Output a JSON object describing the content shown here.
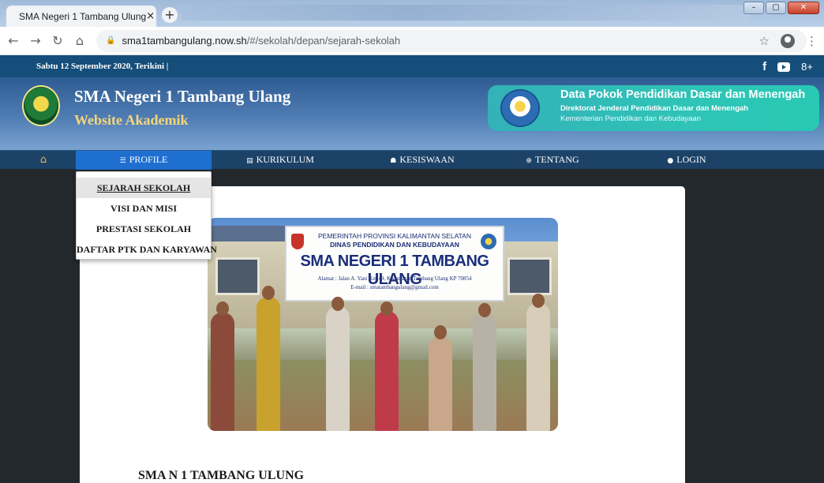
{
  "browser": {
    "tab_title": "SMA Negeri 1 Tambang Ulung",
    "tab_close": "×",
    "new_tab": "+",
    "url_host": "sma1tambangulang.now.sh",
    "url_path": "/#/sekolah/depan/sejarah-sekolah",
    "window_buttons": [
      "–",
      "▢",
      "✕"
    ]
  },
  "topbar": {
    "date_text": "Sabtu 12 September 2020, Terikini |",
    "social": {
      "facebook": "f",
      "youtube": "youtube",
      "googleplus": "8+"
    }
  },
  "header": {
    "site_name": "SMA Negeri 1 Tambang Ulang",
    "site_subtitle": "Website Akademik",
    "dapodik": {
      "title": "Data Pokok Pendidikan Dasar dan Menengah",
      "line2": "Direktorat Jenderal Pendidikan Dasar dan Menengah",
      "line3": "Kementerian Pendidikan dan Kebudayaan"
    }
  },
  "nav": {
    "home_icon": "⌂",
    "items": [
      {
        "icon": "☰",
        "label": "PROFILE"
      },
      {
        "icon": "▤",
        "label": "KURIKULUM"
      },
      {
        "icon": "☗",
        "label": "KESISWAAN"
      },
      {
        "icon": "⊕",
        "label": "TENTANG"
      },
      {
        "icon": "●",
        "label": "LOGIN"
      }
    ]
  },
  "dropdown": {
    "items": [
      "SEJARAH SEKOLAH",
      "VISI DAN MISI",
      "PRESTASI SEKOLAH",
      "DAFTAR PTK DAN KARYAWAN"
    ]
  },
  "photo_banner": {
    "line1": "PEMERINTAH PROVINSI KALIMANTAN SELATAN",
    "line2": "DINAS PENDIDIKAN DAN KEBUDAYAAN",
    "line3": "SMA NEGERI 1 TAMBANG ULANG",
    "line4": "Alamat : Jalan A. Yani Km 49, Kecamatan Tambang Ulang KP 70854",
    "line5": "E-mail : smatambangulang@gmail.com"
  },
  "content": {
    "title": "SMA N 1 TAMBANG ULUNG"
  },
  "colors": {
    "topbar": "#154e7a",
    "nav": "#1c4268",
    "nav_active": "#1f6fd1",
    "page_bg": "#23282d",
    "dapodik": "#2fc4b7"
  }
}
